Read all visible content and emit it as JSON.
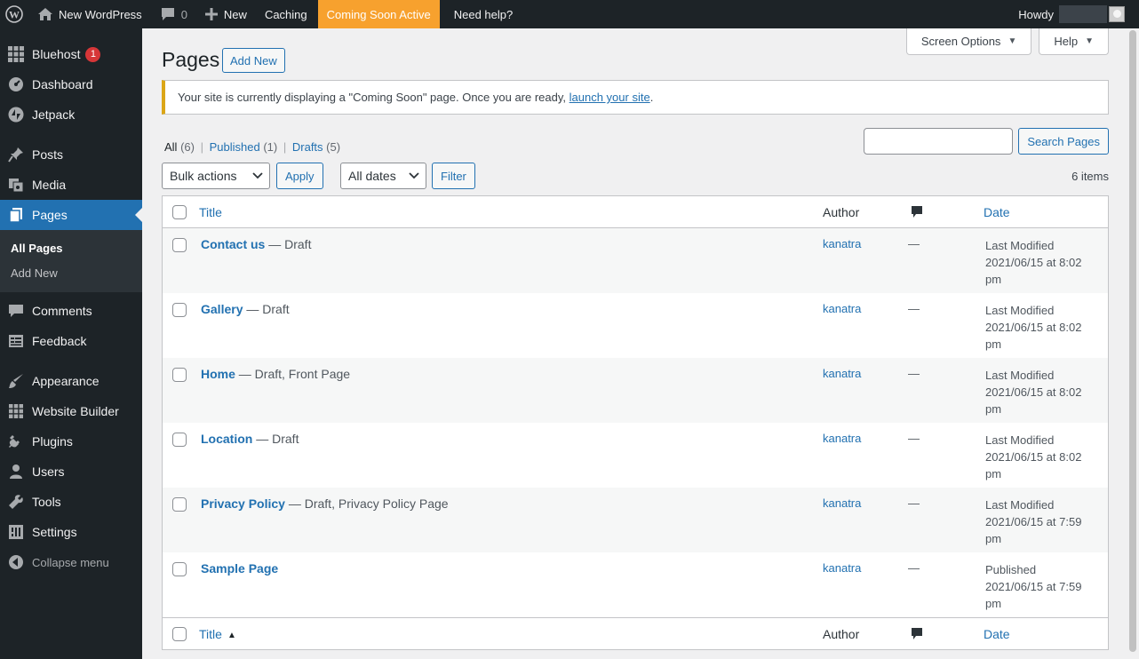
{
  "adminbar": {
    "site_name": "New WordPress",
    "comments_count": "0",
    "new_label": "New",
    "caching_label": "Caching",
    "coming_soon_label": "Coming Soon Active",
    "help_label": "Need help?",
    "howdy_label": "Howdy"
  },
  "sidebar": {
    "bluehost_label": "Bluehost",
    "bluehost_badge": "1",
    "dashboard_label": "Dashboard",
    "jetpack_label": "Jetpack",
    "posts_label": "Posts",
    "media_label": "Media",
    "pages_label": "Pages",
    "submenu": [
      "All Pages",
      "Add New"
    ],
    "comments_label": "Comments",
    "feedback_label": "Feedback",
    "appearance_label": "Appearance",
    "website_builder_label": "Website Builder",
    "plugins_label": "Plugins",
    "users_label": "Users",
    "tools_label": "Tools",
    "settings_label": "Settings",
    "collapse_label": "Collapse menu"
  },
  "screen_options": {
    "screen_options_label": "Screen Options",
    "help_label": "Help"
  },
  "header": {
    "title": "Pages",
    "add_new_label": "Add New"
  },
  "notice": {
    "text_before": "Your site is currently displaying a \"Coming Soon\" page. Once you are ready, ",
    "link": "launch your site",
    "text_after": "."
  },
  "views": {
    "all_label": "All",
    "all_count": "(6)",
    "published_label": "Published",
    "published_count": "(1)",
    "drafts_label": "Drafts",
    "drafts_count": "(5)",
    "separator": "|"
  },
  "search": {
    "button_label": "Search Pages",
    "value": ""
  },
  "tablenav": {
    "bulk_actions": "Bulk actions",
    "apply_label": "Apply",
    "dates": "All dates",
    "filter_label": "Filter",
    "items_count": "6 items"
  },
  "table": {
    "headers": {
      "title": "Title",
      "author": "Author",
      "date": "Date"
    },
    "rows": [
      {
        "title": "Contact us",
        "state": " — Draft",
        "author": "kanatra",
        "comments": "—",
        "date_status": "Last Modified",
        "date_value": "2021/06/15 at 8:02 pm"
      },
      {
        "title": "Gallery",
        "state": " — Draft",
        "author": "kanatra",
        "comments": "—",
        "date_status": "Last Modified",
        "date_value": "2021/06/15 at 8:02 pm"
      },
      {
        "title": "Home",
        "state": " — Draft, Front Page",
        "author": "kanatra",
        "comments": "—",
        "date_status": "Last Modified",
        "date_value": "2021/06/15 at 8:02 pm"
      },
      {
        "title": "Location",
        "state": " — Draft",
        "author": "kanatra",
        "comments": "—",
        "date_status": "Last Modified",
        "date_value": "2021/06/15 at 8:02 pm"
      },
      {
        "title": "Privacy Policy",
        "state": " — Draft, Privacy Policy Page",
        "author": "kanatra",
        "comments": "—",
        "date_status": "Last Modified",
        "date_value": "2021/06/15 at 7:59 pm"
      },
      {
        "title": "Sample Page",
        "state": "",
        "author": "kanatra",
        "comments": "—",
        "date_status": "Published",
        "date_value": "2021/06/15 at 7:59 pm"
      }
    ]
  },
  "colors": {
    "admin_bar_bg": "#1d2327",
    "accent_blue": "#2271b1",
    "coming_soon_orange": "#f7a12e",
    "notice_border": "#dba617",
    "badge_red": "#d63638"
  }
}
